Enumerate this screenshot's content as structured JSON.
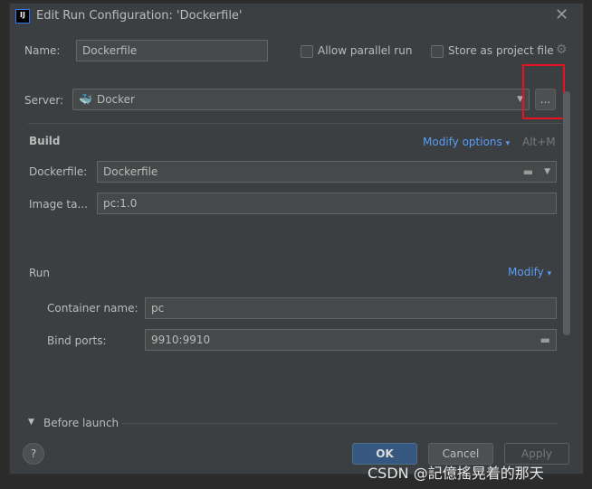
{
  "dialog": {
    "title": "Edit Run Configuration: 'Dockerfile'"
  },
  "name": {
    "label": "Name:",
    "value": "Dockerfile"
  },
  "options": {
    "allow_parallel": "Allow parallel run",
    "store_project": "Store as project file"
  },
  "server": {
    "label": "Server:",
    "value": "Docker",
    "more": "..."
  },
  "build": {
    "title": "Build",
    "modify": "Modify options",
    "shortcut": "Alt+M",
    "dockerfile_label": "Dockerfile:",
    "dockerfile_value": "Dockerfile",
    "image_label": "Image ta...",
    "image_value": "pc:1.0"
  },
  "run": {
    "title": "Run",
    "modify": "Modify",
    "container_label": "Container name:",
    "container_value": "pc",
    "ports_label": "Bind ports:",
    "ports_value": "9910:9910"
  },
  "before_launch": "Before launch",
  "buttons": {
    "ok": "OK",
    "cancel": "Cancel",
    "apply": "Apply",
    "help": "?"
  },
  "watermark": "CSDN @記億搖晃着的那天",
  "colors": {
    "accent": "#589df6",
    "ok": "#365880",
    "highlight": "#e81123"
  }
}
